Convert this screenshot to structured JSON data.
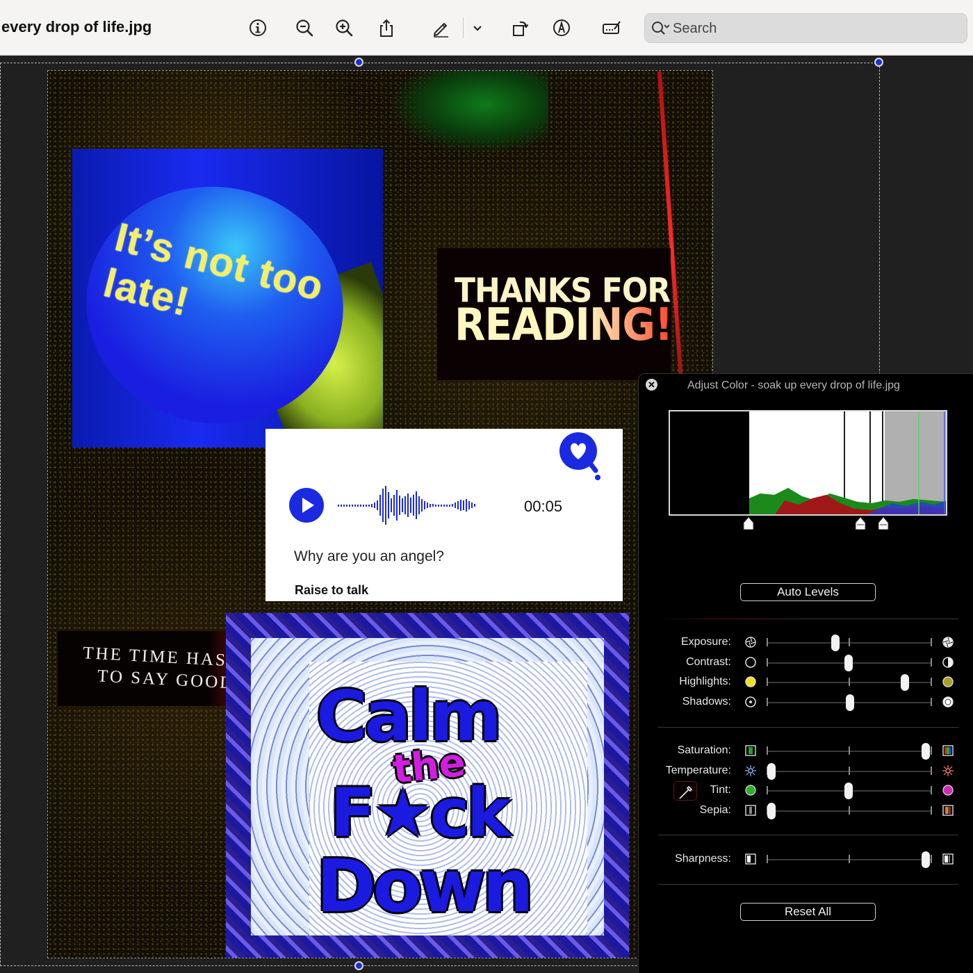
{
  "window": {
    "title": "every drop of life.jpg"
  },
  "toolbar": {
    "buttons": [
      {
        "name": "info-icon"
      },
      {
        "name": "zoom-out-icon"
      },
      {
        "name": "zoom-in-icon"
      },
      {
        "name": "share-icon"
      },
      {
        "name": "markup-pen-icon"
      },
      {
        "name": "chevron-down-icon"
      },
      {
        "name": "rotate-icon"
      },
      {
        "name": "annotate-icon"
      },
      {
        "name": "sign-icon"
      }
    ],
    "search": {
      "placeholder": "Search"
    }
  },
  "image": {
    "sticker_1": "It’s not too late!",
    "sticker_2_line1": "THANKS FOR",
    "sticker_2_line2": "READING!",
    "voice_card": {
      "time": "00:05",
      "question": "Why are you an angel?",
      "action": "Raise to talk"
    },
    "sticker_3_line1": "THE TIME HAS COME",
    "sticker_3_line2": "TO SAY GOODBYE",
    "sticker_4": {
      "w1": "Calm",
      "w2": "the",
      "w3": "F★ck",
      "w4": "Down"
    }
  },
  "adjust_color": {
    "title": "Adjust Color - soak up every drop of life.jpg",
    "auto_levels": "Auto Levels",
    "reset_all": "Reset All",
    "sliders": [
      {
        "label": "Exposure:",
        "value": 0.42
      },
      {
        "label": "Contrast:",
        "value": 0.5
      },
      {
        "label": "Highlights:",
        "value": 0.85
      },
      {
        "label": "Shadows:",
        "value": 0.51
      },
      {
        "label": "Saturation:",
        "value": 0.98
      },
      {
        "label": "Temperature:",
        "value": 0.02
      },
      {
        "label": "Tint:",
        "value": 0.5
      },
      {
        "label": "Sepia:",
        "value": 0.02
      },
      {
        "label": "Sharpness:",
        "value": 0.98
      }
    ]
  },
  "colors": {
    "accent_blue": "#1a2ae0",
    "selection_handle": "#1a2fd0"
  }
}
